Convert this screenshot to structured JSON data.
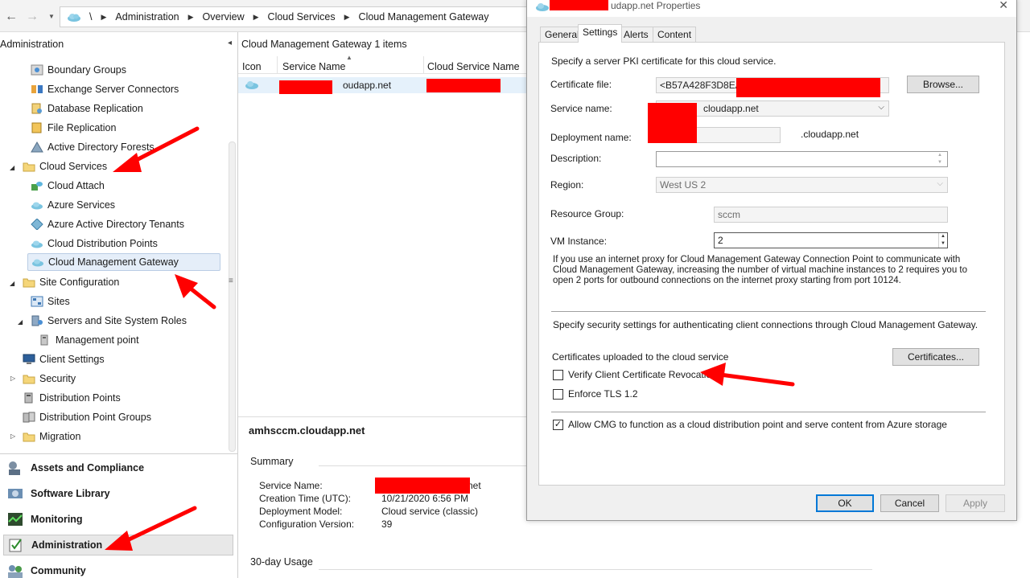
{
  "address_bar": {
    "root_separator": "\\",
    "breadcrumbs": [
      "Administration",
      "Overview",
      "Cloud Services",
      "Cloud Management Gateway"
    ],
    "back_icon": "←",
    "forward_icon": "→"
  },
  "left_pane": {
    "header": "Administration",
    "collapse_icon": "◂",
    "tree": [
      {
        "label": "Boundary Groups",
        "icon": "boundary-groups-icon"
      },
      {
        "label": "Exchange Server Connectors",
        "icon": "exchange-connector-icon"
      },
      {
        "label": "Database Replication",
        "icon": "database-replication-icon"
      },
      {
        "label": "File Replication",
        "icon": "file-replication-icon"
      },
      {
        "label": "Active Directory Forests",
        "icon": "ad-forest-icon"
      },
      {
        "label": "Cloud Services",
        "icon": "folder-icon",
        "expanded": true
      },
      {
        "label": "Cloud Attach",
        "icon": "cloud-attach-icon"
      },
      {
        "label": "Azure Services",
        "icon": "cloud-icon"
      },
      {
        "label": "Azure Active Directory Tenants",
        "icon": "azure-ad-icon"
      },
      {
        "label": "Cloud Distribution Points",
        "icon": "cloud-icon"
      },
      {
        "label": "Cloud Management Gateway",
        "icon": "cloud-icon",
        "selected": true
      },
      {
        "label": "Site Configuration",
        "icon": "folder-icon",
        "expanded": true
      },
      {
        "label": "Sites",
        "icon": "sites-icon"
      },
      {
        "label": "Servers and Site System Roles",
        "icon": "servers-icon",
        "expanded": true
      },
      {
        "label": "Management point",
        "icon": "management-point-icon"
      },
      {
        "label": "Client Settings",
        "icon": "client-settings-icon"
      },
      {
        "label": "Security",
        "icon": "folder-icon",
        "expanded": false
      },
      {
        "label": "Distribution Points",
        "icon": "distribution-points-icon"
      },
      {
        "label": "Distribution Point Groups",
        "icon": "distribution-point-groups-icon"
      },
      {
        "label": "Migration",
        "icon": "folder-icon",
        "expanded": false
      }
    ],
    "workspaces": [
      {
        "label": "Assets and Compliance",
        "icon": "assets-icon"
      },
      {
        "label": "Software Library",
        "icon": "software-library-icon"
      },
      {
        "label": "Monitoring",
        "icon": "monitoring-icon"
      },
      {
        "label": "Administration",
        "icon": "administration-icon",
        "selected": true
      },
      {
        "label": "Community",
        "icon": "community-icon"
      }
    ]
  },
  "list": {
    "title": "Cloud Management Gateway 1 items",
    "columns": [
      "Icon",
      "Service Name",
      "Cloud Service Name"
    ],
    "rows": [
      {
        "service_name_visible": "oudapp.net"
      }
    ]
  },
  "details": {
    "title": "amhsccm.cloudapp.net",
    "summary_heading": "Summary",
    "fields": [
      {
        "label": "Service Name:",
        "value": "net"
      },
      {
        "label": "Creation Time (UTC):",
        "value": "10/21/2020 6:56 PM"
      },
      {
        "label": "Deployment Model:",
        "value": "Cloud service (classic)"
      },
      {
        "label": "Configuration Version:",
        "value": "39"
      }
    ],
    "usage_heading": "30-day Usage"
  },
  "dialog": {
    "title_visible": "udapp.net Properties",
    "close_icon": "✕",
    "tabs": [
      "General",
      "Settings",
      "Alerts",
      "Content"
    ],
    "active_tab": "Settings",
    "intro": "Specify a server PKI certificate for this cloud service.",
    "certificate_file_label": "Certificate file:",
    "certificate_file_value": "<B57A428F3D8EA6",
    "browse_button": "Browse...",
    "service_name_label": "Service name:",
    "service_name_value": "cloudapp.net",
    "deployment_name_label": "Deployment name:",
    "deployment_suffix": ".cloudapp.net",
    "description_label": "Description:",
    "description_value": "",
    "region_label": "Region:",
    "region_value": "West US 2",
    "resource_group_label": "Resource Group:",
    "resource_group_value": "sccm",
    "vm_instance_label": "VM Instance:",
    "vm_instance_value": "2",
    "proxy_info": "If you use an internet proxy for Cloud Management Gateway Connection Point to communicate with Cloud Management Gateway, increasing the number of virtual machine instances to 2 requires you to open 2 ports for outbound connections on the internet proxy starting from port 10124.",
    "security_intro": "Specify security settings for authenticating client connections through Cloud Management Gateway.",
    "certificates_uploaded_label": "Certificates uploaded to the cloud service",
    "certificates_button": "Certificates...",
    "verify_revocation_label": "Verify Client Certificate Revocation",
    "verify_revocation_checked": false,
    "enforce_tls_label": "Enforce TLS 1.2",
    "enforce_tls_checked": false,
    "allow_cdp_label": "Allow CMG to function as a cloud distribution point and serve content from Azure storage",
    "allow_cdp_checked": true,
    "check_mark": "✓",
    "ok_button": "OK",
    "cancel_button": "Cancel",
    "apply_button": "Apply"
  },
  "colors": {
    "annotation_red": "#ff0000",
    "selection_blue": "#e5f1fb",
    "default_button_border": "#0078d7"
  }
}
